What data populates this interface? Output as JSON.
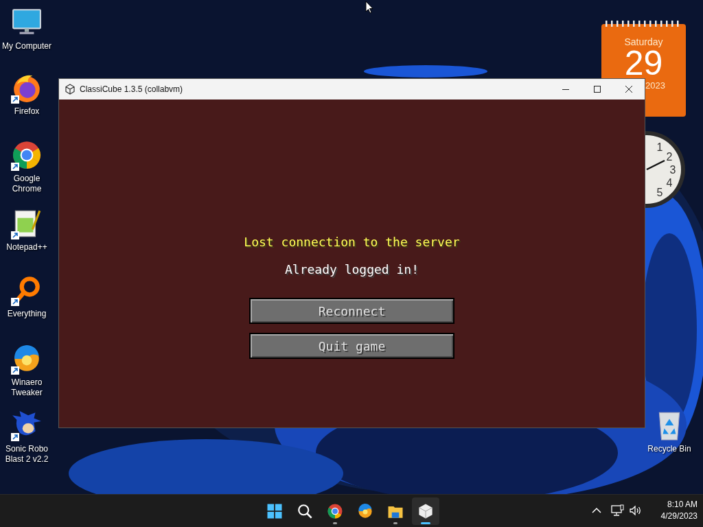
{
  "desktop_icons": [
    {
      "label": "My Computer",
      "kind": "computer",
      "shortcut": false
    },
    {
      "label": "Firefox",
      "kind": "firefox",
      "shortcut": true
    },
    {
      "label": "Google Chrome",
      "kind": "chrome",
      "shortcut": true
    },
    {
      "label": "Notepad++",
      "kind": "notepad",
      "shortcut": true
    },
    {
      "label": "Everything",
      "kind": "everything",
      "shortcut": true
    },
    {
      "label": "Winaero Tweaker",
      "kind": "winaero",
      "shortcut": true
    },
    {
      "label": "Sonic Robo Blast 2 v2.2",
      "kind": "game",
      "shortcut": true
    },
    {
      "label": "Recycle Bin",
      "kind": "recycle",
      "shortcut": false
    }
  ],
  "calendar_gadget": {
    "weekday": "Saturday",
    "day": "29",
    "year": "2023"
  },
  "clock_gadget": {
    "numerals": [
      "1",
      "2",
      "3",
      "4",
      "5"
    ]
  },
  "window": {
    "title": "ClassiCube 1.3.5 (collabvm)",
    "heading": "Lost connection to the server",
    "message": "Already logged in!",
    "buttons": [
      "Reconnect",
      "Quit game"
    ]
  },
  "taskbar": {
    "items": [
      {
        "kind": "start",
        "running": false,
        "selected": false
      },
      {
        "kind": "search",
        "running": false,
        "selected": false
      },
      {
        "kind": "chrome",
        "running": true,
        "selected": false
      },
      {
        "kind": "winaero",
        "running": false,
        "selected": false
      },
      {
        "kind": "explorer",
        "running": true,
        "selected": false
      },
      {
        "kind": "classicube",
        "running": true,
        "selected": true
      }
    ],
    "time": "8:10 AM",
    "date": "4/29/2023"
  }
}
